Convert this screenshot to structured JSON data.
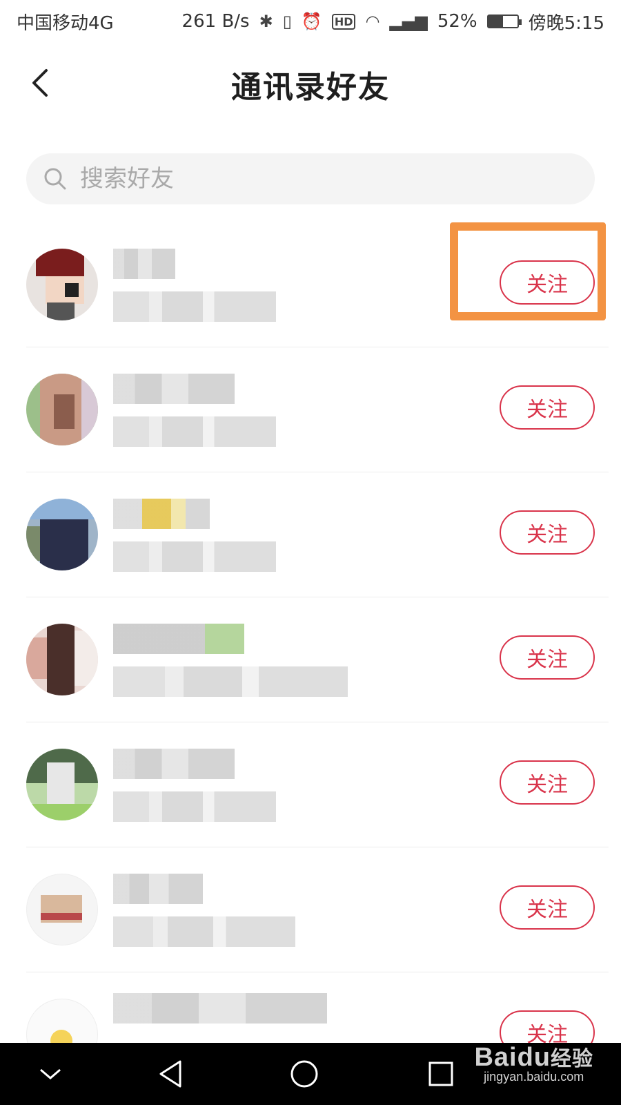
{
  "status_bar": {
    "carrier": "中国移动4G",
    "speed": "261 B/s",
    "battery_percent": "52%",
    "battery_level": 0.52,
    "time": "傍晚5:15",
    "icons": [
      "bluetooth-icon",
      "vibrate-icon",
      "alarm-icon",
      "hd-icon",
      "wifi-icon",
      "signal-icon",
      "battery-icon"
    ]
  },
  "header": {
    "title": "通讯录好友",
    "back_icon": "chevron-left-icon"
  },
  "search": {
    "placeholder": "搜索好友",
    "icon": "search-icon"
  },
  "friends": [
    {
      "follow_label": "关注"
    },
    {
      "follow_label": "关注"
    },
    {
      "follow_label": "关注"
    },
    {
      "follow_label": "关注"
    },
    {
      "follow_label": "关注"
    },
    {
      "follow_label": "关注"
    },
    {
      "follow_label": "关注"
    }
  ],
  "nav_bar": {
    "icons": [
      "collapse-icon",
      "back-triangle-icon",
      "home-circle-icon",
      "recents-square-icon"
    ]
  },
  "watermark": {
    "brand": "Baidu",
    "brand_suffix": "经验",
    "url": "jingyan.baidu.com"
  },
  "colors": {
    "accent": "#d9334a",
    "highlight": "#f39343",
    "search_bg": "#f4f4f4",
    "nav_bg": "#000000"
  }
}
